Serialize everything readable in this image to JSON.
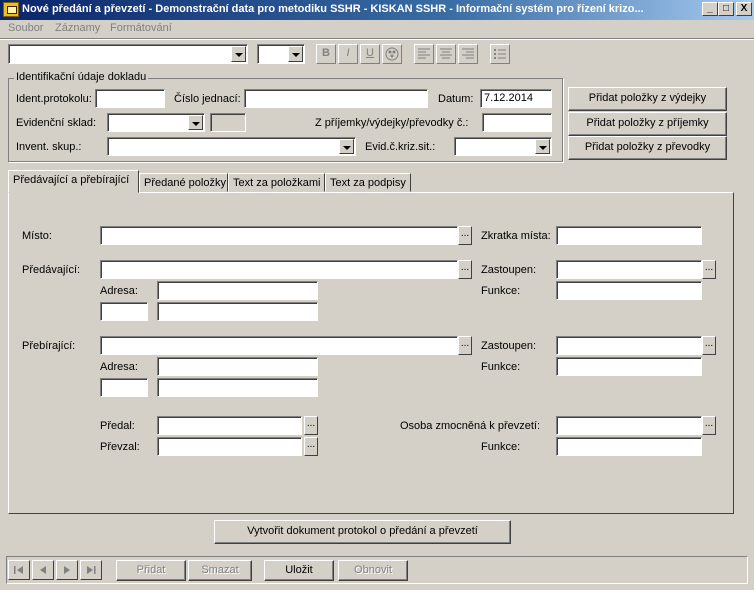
{
  "window": {
    "title": "Nové předání a převzetí - Demonstrační data pro metodiku SSHR - KISKAN SSHR - Informační systém pro řízení krizo...",
    "minimize": "_",
    "maximize": "□",
    "close": "X"
  },
  "menu": [
    "Soubor",
    "Záznamy",
    "Formátování"
  ],
  "toolbar": {
    "bold": "B",
    "italic": "I",
    "underline": "U"
  },
  "ident": {
    "group_title": "Identifikační údaje dokladu",
    "protokol_label": "Ident.protokolu:",
    "protokol_value": "",
    "cislo_label": "Číslo jednací:",
    "cislo_value": "",
    "datum_label": "Datum:",
    "datum_value": "7.12.2014",
    "sklad_label": "Evidenční sklad:",
    "sklad_value": "",
    "prijemky_label": "Z příjemky/výdejky/převodky č.:",
    "prijemky_value": "",
    "skup_label": "Invent. skup.:",
    "skup_value": "",
    "evid_label": "Evid.č.kriz.sit.:",
    "evid_value": ""
  },
  "side_buttons": {
    "vydejky": "Přidat položky z výdejky",
    "prijemky": "Přidat položky z příjemky",
    "prevodky": "Přidat položky z převodky"
  },
  "tabs": [
    "Předávající a přebírající",
    "Předané položky",
    "Text za položkami",
    "Text za podpisy"
  ],
  "form": {
    "misto_label": "Místo:",
    "zkratka_label": "Zkratka místa:",
    "predavajici_label": "Předávající:",
    "zastoupen_label": "Zastoupen:",
    "adresa_label": "Adresa:",
    "funkce_label": "Funkce:",
    "prebirajici_label": "Přebírající:",
    "zastoupen2_label": "Zastoupen:",
    "adresa2_label": "Adresa:",
    "funkce2_label": "Funkce:",
    "predal_label": "Předal:",
    "prevzal_label": "Převzal:",
    "osoba_label": "Osoba zmocněná k převzetí:",
    "funkce3_label": "Funkce:",
    "ellipsis": "..."
  },
  "create_button": "Vytvořit dokument protokol o předání a převzetí",
  "bottom": {
    "pridat": "Přidat",
    "smazat": "Smazat",
    "ulozit": "Uložit",
    "obnovit": "Obnovit"
  }
}
